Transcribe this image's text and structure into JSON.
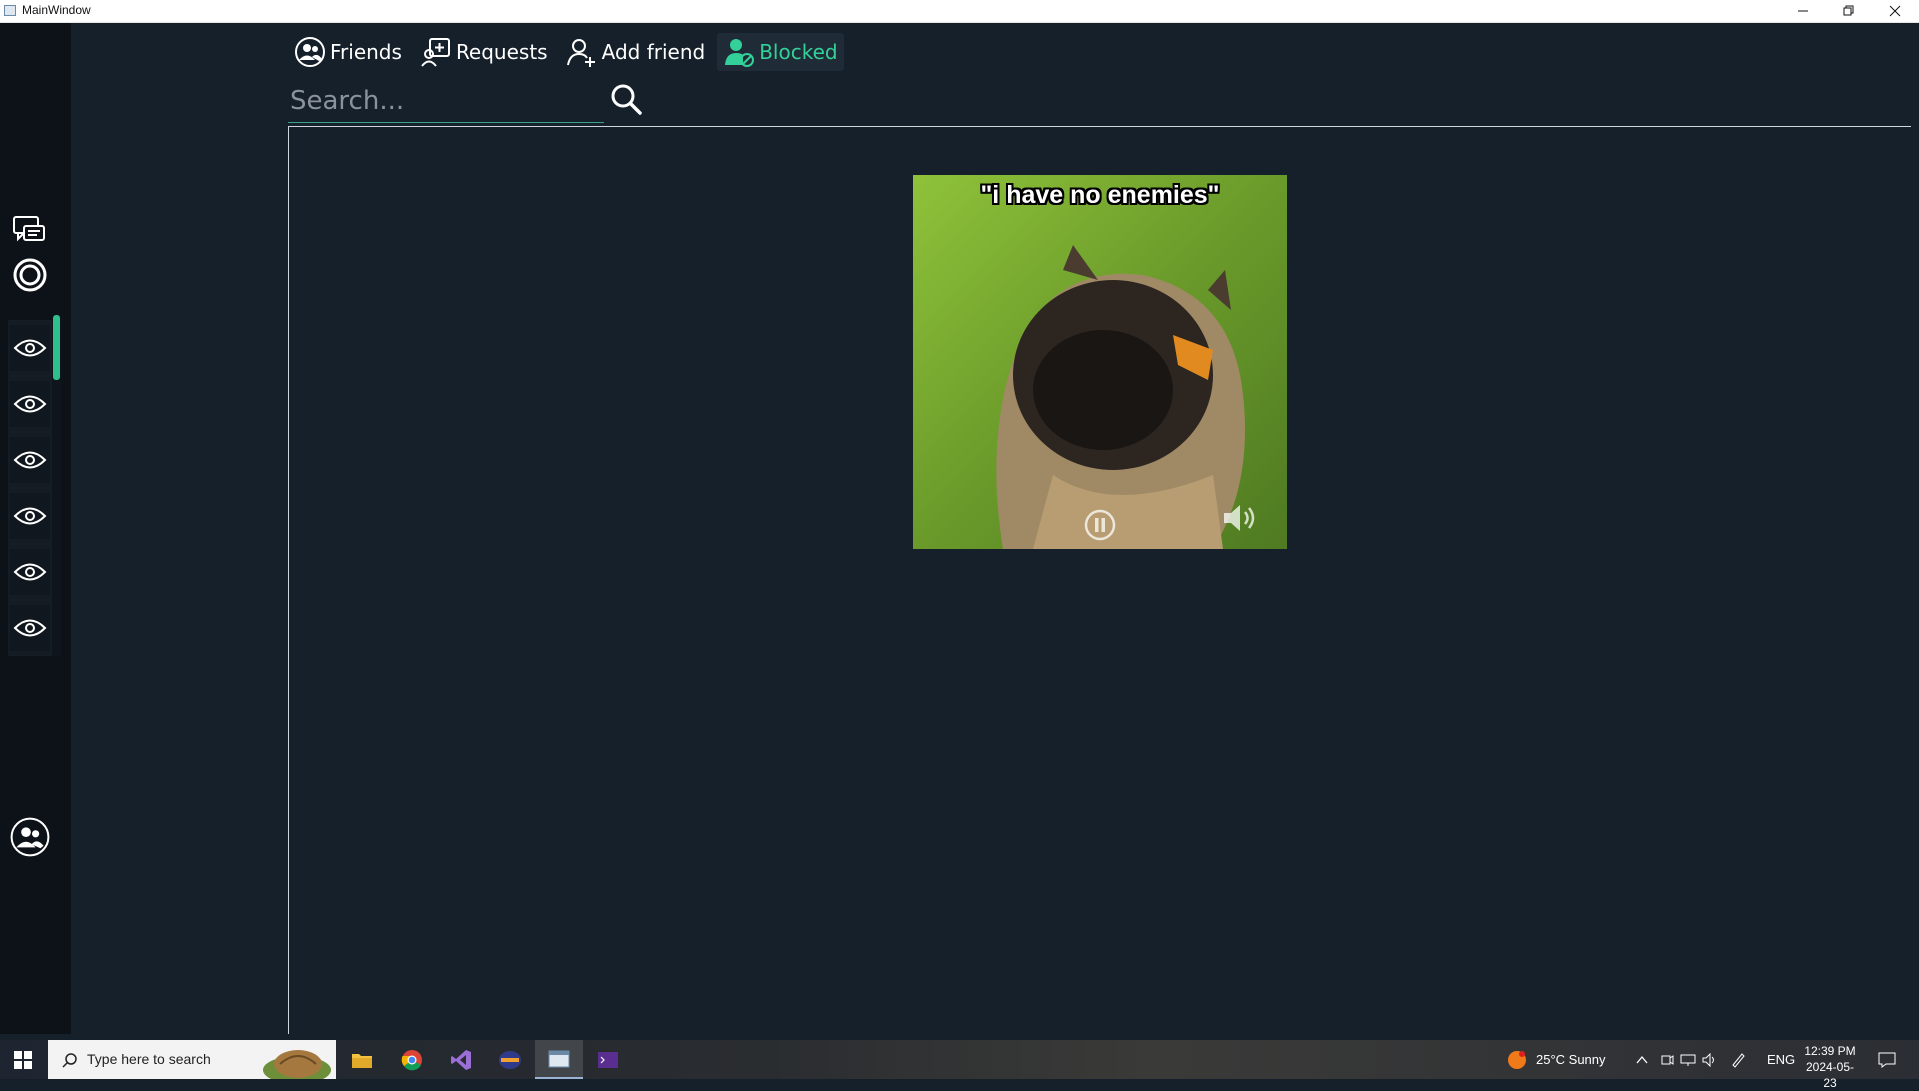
{
  "window": {
    "title": "MainWindow"
  },
  "tabs": [
    {
      "label": "Friends",
      "icon": "friends-icon",
      "active": false
    },
    {
      "label": "Requests",
      "icon": "requests-icon",
      "active": false
    },
    {
      "label": "Add friend",
      "icon": "add-friend-icon",
      "active": false
    },
    {
      "label": "Blocked",
      "icon": "blocked-icon",
      "active": true
    }
  ],
  "search": {
    "placeholder": "Search..."
  },
  "media": {
    "caption": "\"i have no enemies\""
  },
  "taskbar": {
    "search_placeholder": "Type here to search",
    "weather": "25°C  Sunny",
    "language": "ENG",
    "time": "12:39 PM",
    "date": "2024-05-23"
  },
  "colors": {
    "accent": "#33d199",
    "background": "#16202a",
    "sidebar": "#0d1218"
  }
}
